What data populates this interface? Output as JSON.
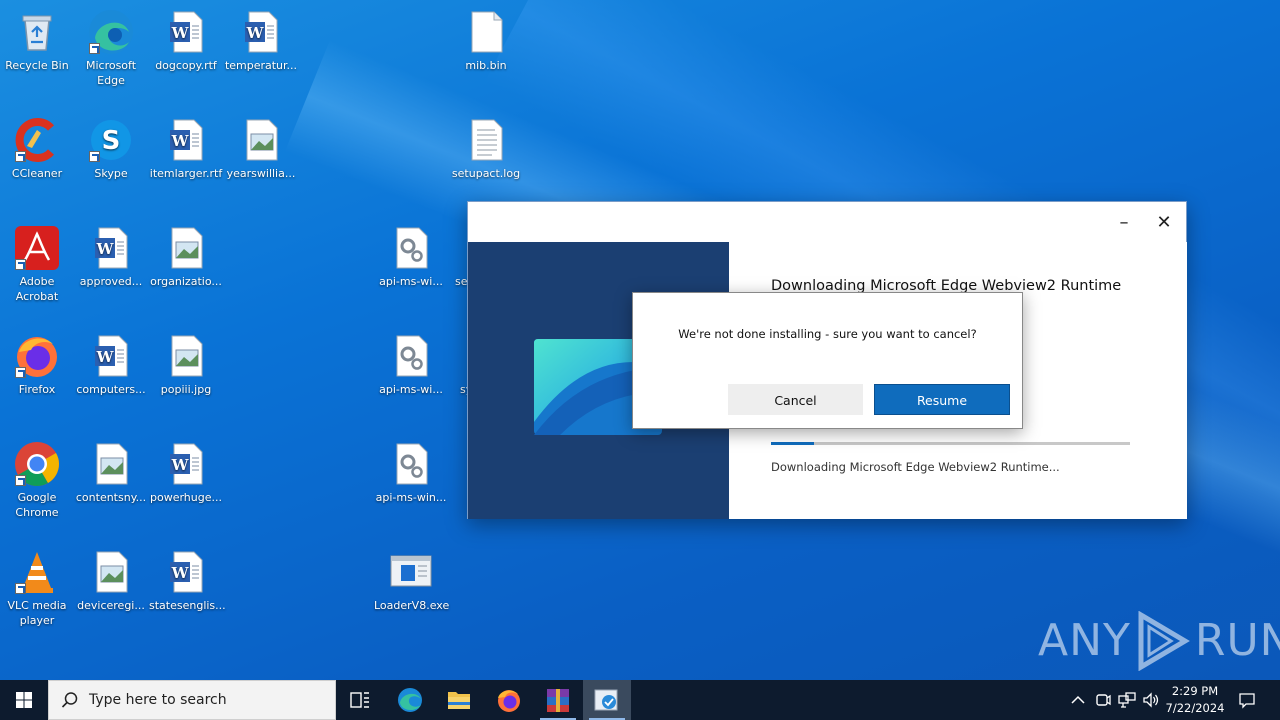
{
  "desktop_icons": [
    {
      "label": "Recycle Bin",
      "icon": "recycle-bin-icon"
    },
    {
      "label": "Microsoft Edge",
      "icon": "edge-icon"
    },
    {
      "label": "dogcopy.rtf",
      "icon": "word-doc-icon"
    },
    {
      "label": "temperatur...",
      "icon": "word-doc-icon"
    },
    {
      "label": "mib.bin",
      "icon": "blank-file-icon"
    },
    {
      "label": "CCleaner",
      "icon": "ccleaner-icon"
    },
    {
      "label": "Skype",
      "icon": "skype-icon"
    },
    {
      "label": "itemlarger.rtf",
      "icon": "word-doc-icon"
    },
    {
      "label": "yearswillia...",
      "icon": "image-file-icon"
    },
    {
      "label": "setupact.log",
      "icon": "text-file-icon"
    },
    {
      "label": "Adobe Acrobat",
      "icon": "acrobat-icon"
    },
    {
      "label": "approved...",
      "icon": "word-doc-icon"
    },
    {
      "label": "organizatio...",
      "icon": "image-file-icon"
    },
    {
      "label": "api-ms-wi...",
      "icon": "dll-file-icon"
    },
    {
      "label": "se",
      "icon": "file-icon"
    },
    {
      "label": "Firefox",
      "icon": "firefox-icon"
    },
    {
      "label": "computers...",
      "icon": "word-doc-icon"
    },
    {
      "label": "popiii.jpg",
      "icon": "image-file-icon"
    },
    {
      "label": "api-ms-wi...",
      "icon": "dll-file-icon"
    },
    {
      "label": "sy",
      "icon": "file-icon"
    },
    {
      "label": "Google Chrome",
      "icon": "chrome-icon"
    },
    {
      "label": "contentsny...",
      "icon": "image-file-icon"
    },
    {
      "label": "powerhuge...",
      "icon": "word-doc-icon"
    },
    {
      "label": "api-ms-win...",
      "icon": "dll-file-icon"
    },
    {
      "label": "VLC media player",
      "icon": "vlc-icon"
    },
    {
      "label": "deviceregi...",
      "icon": "image-file-icon"
    },
    {
      "label": "statesenglis...",
      "icon": "word-doc-icon"
    },
    {
      "label": "LoaderV8.exe",
      "icon": "exe-app-icon"
    }
  ],
  "installer": {
    "heading": "Downloading Microsoft Edge Webview2 Runtime",
    "status": "Downloading Microsoft Edge Webview2 Runtime...",
    "progress": 0.12,
    "minimize_glyph": "–",
    "close_glyph": "✕"
  },
  "dialog": {
    "message": "We're not done installing - sure you want to cancel?",
    "cancel_label": "Cancel",
    "resume_label": "Resume"
  },
  "watermark": {
    "left": "ANY",
    "right": "RUN"
  },
  "taskbar": {
    "search_placeholder": "Type here to search",
    "apps": [
      "task-view-icon",
      "edge-icon",
      "file-explorer-icon",
      "firefox-icon",
      "winrar-icon",
      "installer-icon"
    ],
    "time": "2:29 PM",
    "date": "7/22/2024"
  },
  "colors": {
    "accent": "#0f6cbd",
    "installer_left_pane": "#1b3f72",
    "taskbar": "#0d1b2e"
  }
}
